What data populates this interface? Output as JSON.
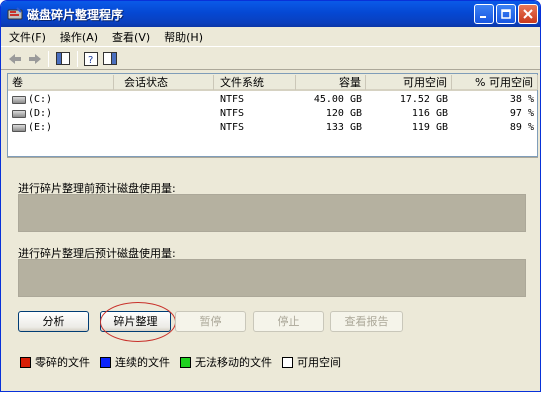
{
  "window": {
    "title": "磁盘碎片整理程序",
    "colors": {
      "titlebar": "#0a5ae8",
      "window_bg": "#ece9d8",
      "graph_bar": "#b5b1a0"
    }
  },
  "menu": {
    "items": [
      "文件(F)",
      "操作(A)",
      "查看(V)",
      "帮助(H)"
    ]
  },
  "toolbar": {
    "icons": [
      "back-arrow-icon",
      "forward-arrow-icon",
      "properties-icon",
      "help-icon",
      "console-tree-icon"
    ]
  },
  "volumes": {
    "headers": [
      "卷",
      "会话状态",
      "文件系统",
      "容量",
      "可用空间",
      "% 可用空间"
    ],
    "rows": [
      {
        "volume": "(C:)",
        "session": "",
        "fs": "NTFS",
        "capacity": "45.00 GB",
        "free": "17.52 GB",
        "pct": "38 %"
      },
      {
        "volume": "(D:)",
        "session": "",
        "fs": "NTFS",
        "capacity": "120 GB",
        "free": "116 GB",
        "pct": "97 %"
      },
      {
        "volume": "(E:)",
        "session": "",
        "fs": "NTFS",
        "capacity": "133 GB",
        "free": "119 GB",
        "pct": "89 %"
      }
    ]
  },
  "analysis": {
    "before_label": "进行碎片整理前预计磁盘使用量:",
    "after_label": "进行碎片整理后预计磁盘使用量:"
  },
  "buttons": {
    "analyze": "分析",
    "defragment": "碎片整理",
    "pause": "暂停",
    "stop": "停止",
    "view_report": "查看报告"
  },
  "legend": [
    {
      "label": "零碎的文件",
      "color": "#d81e06"
    },
    {
      "label": "连续的文件",
      "color": "#0b24fb"
    },
    {
      "label": "无法移动的文件",
      "color": "#1fd11f"
    },
    {
      "label": "可用空间",
      "color": "#ffffff"
    }
  ]
}
